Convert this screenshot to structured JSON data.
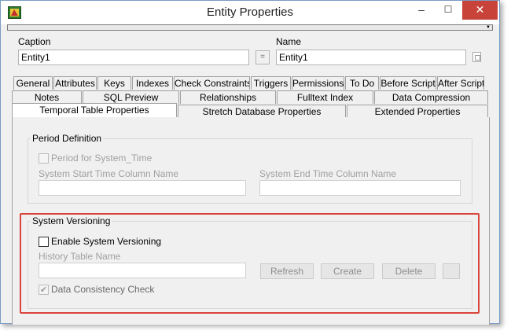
{
  "window": {
    "title": "Entity Properties",
    "minimize": "–",
    "maximize": "☐",
    "close": "✕"
  },
  "caption": {
    "label": "Caption",
    "value": "Entity1"
  },
  "equals_button": "=",
  "name": {
    "label": "Name",
    "value": "Entity1"
  },
  "tabs_row1": [
    "General",
    "Attributes",
    "Keys",
    "Indexes",
    "Check Constraints",
    "Triggers",
    "Permissions",
    "To Do",
    "Before Script",
    "After Script"
  ],
  "tabs_row2": [
    "Notes",
    "SQL Preview",
    "Relationships",
    "Fulltext Index",
    "Data Compression"
  ],
  "tabs_row3": [
    "Temporal Table Properties",
    "Stretch Database Properties",
    "Extended Properties"
  ],
  "period": {
    "title": "Period Definition",
    "checkbox_label": "Period for System_Time",
    "start_label": "System Start Time Column Name",
    "end_label": "System End Time Column Name"
  },
  "versioning": {
    "title": "System Versioning",
    "enable_label": "Enable System Versioning",
    "history_label": "History Table Name",
    "refresh": "Refresh",
    "create": "Create",
    "delete": "Delete",
    "consistency_label": "Data Consistency Check"
  },
  "colors": {
    "highlight": "#d9453c",
    "close_button": "#c8443a"
  }
}
